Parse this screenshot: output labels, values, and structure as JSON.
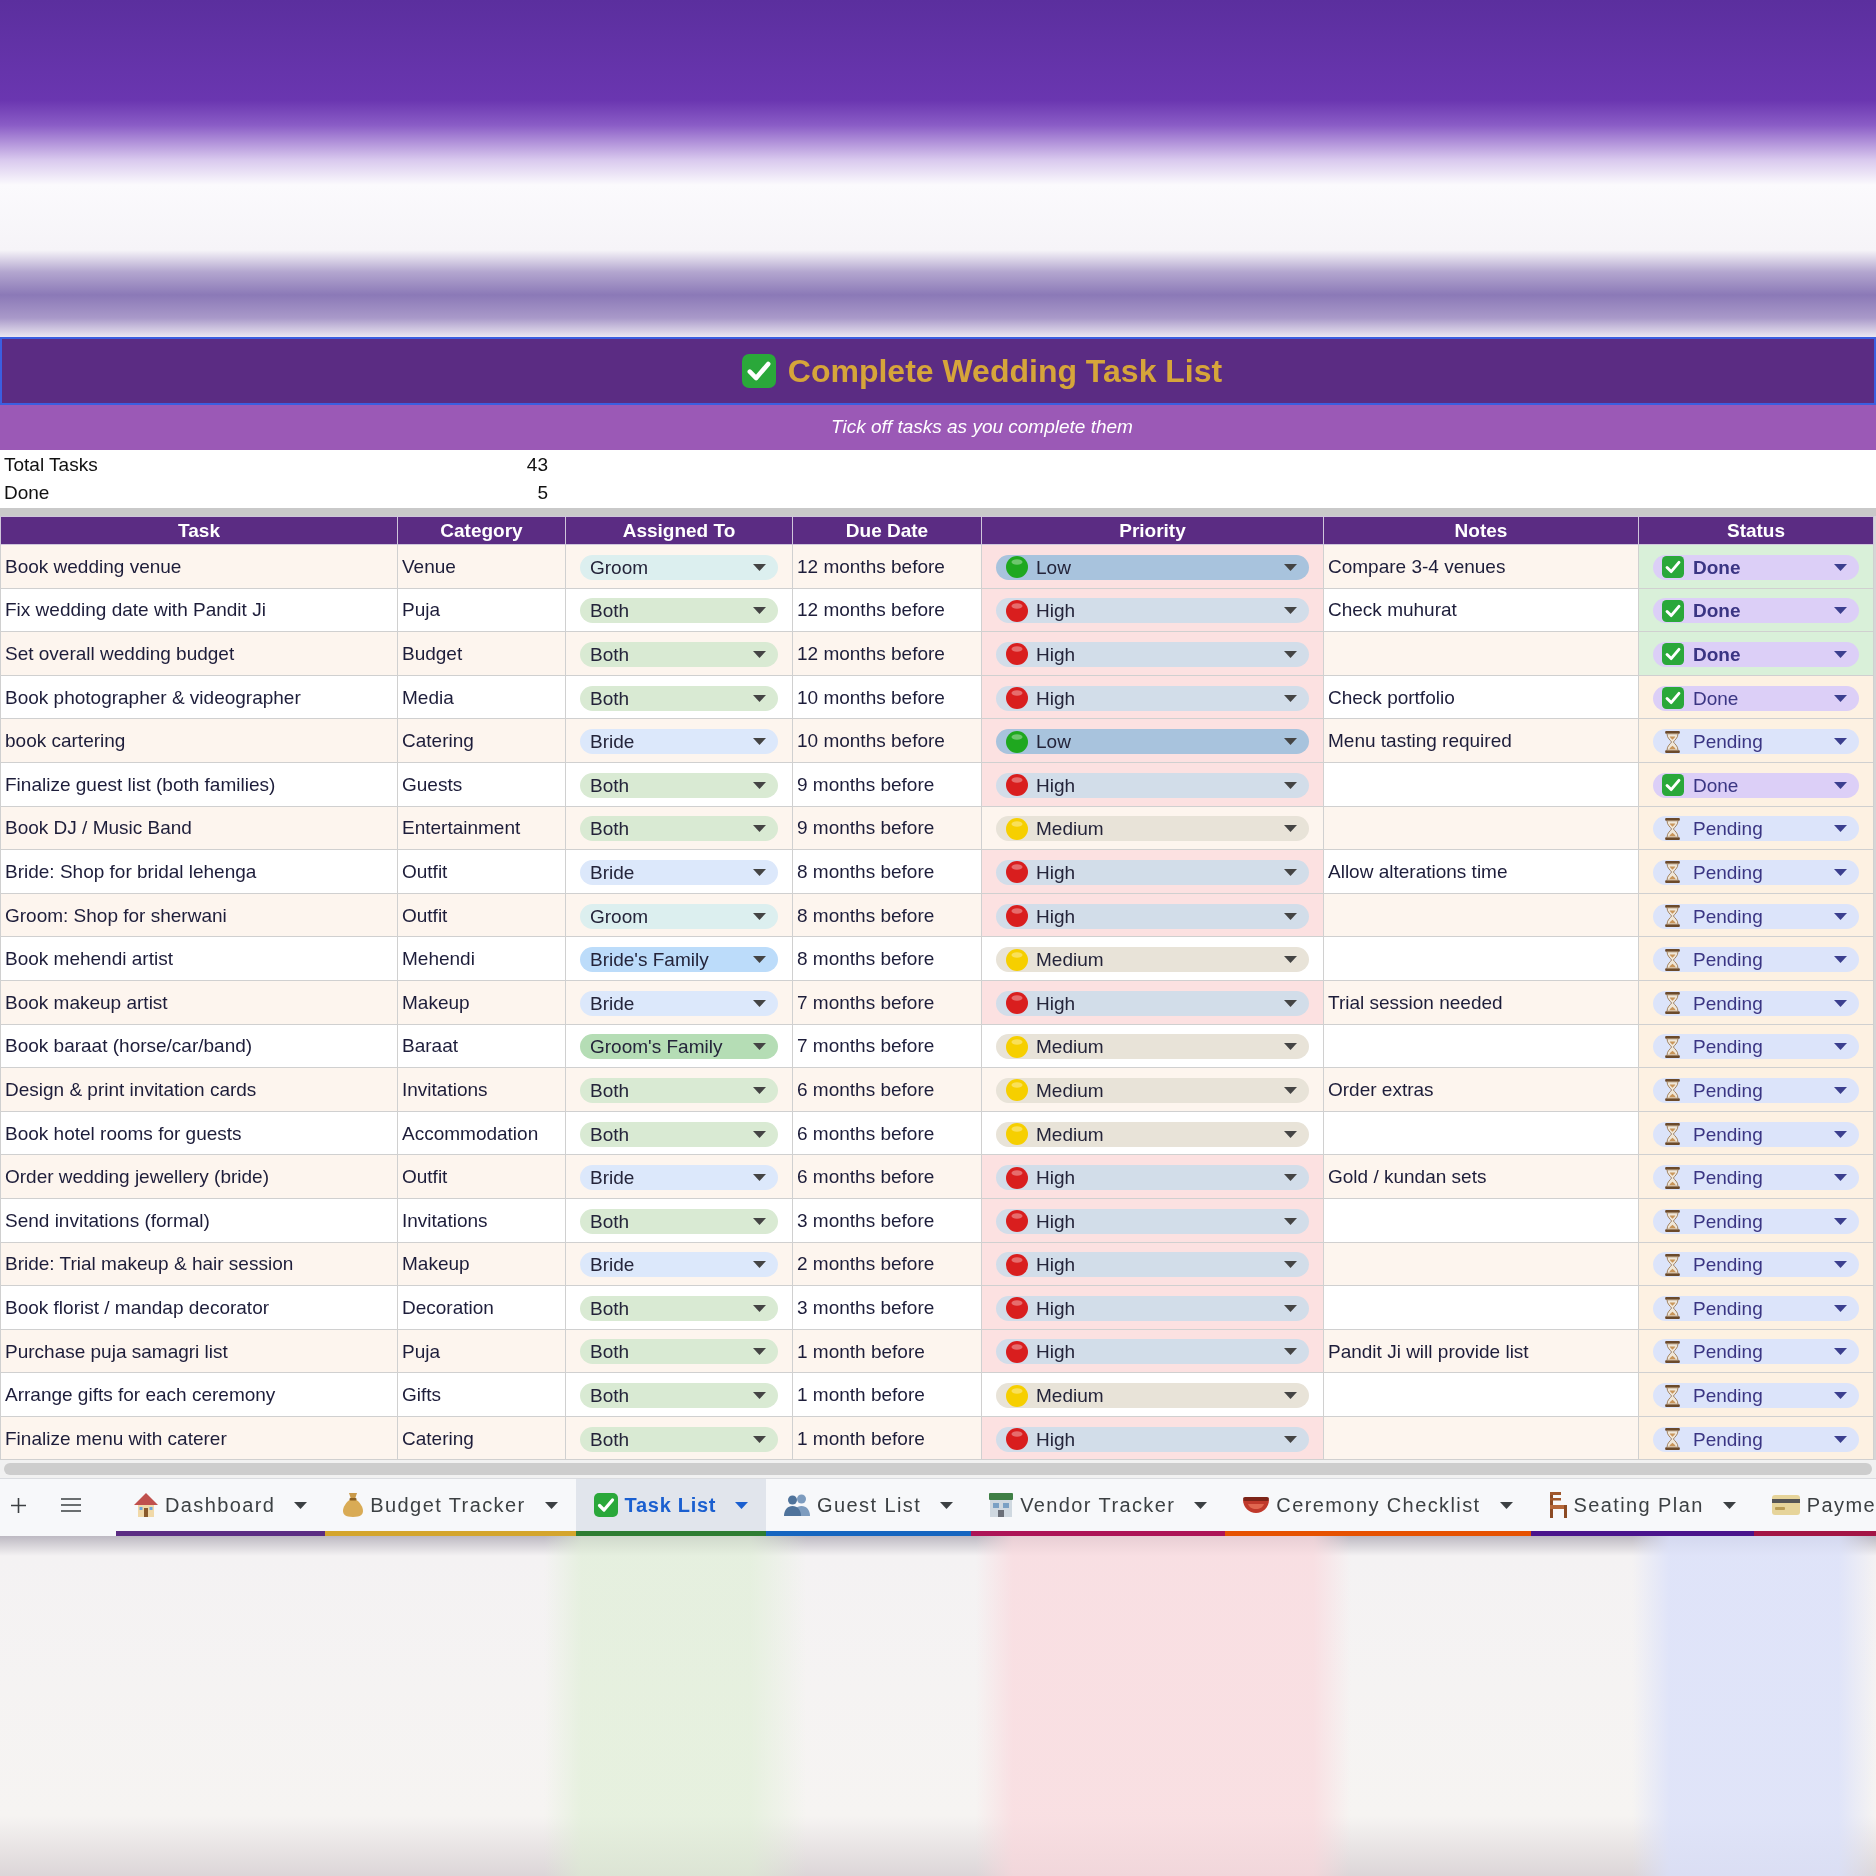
{
  "title_banner": {
    "text": "Complete Wedding Task List",
    "selected": true
  },
  "subtitle": "Tick off tasks as you complete them",
  "summary": [
    {
      "label": "Total Tasks",
      "value": "43"
    },
    {
      "label": "Done",
      "value": "5"
    }
  ],
  "table": {
    "columns": [
      "Task",
      "Category",
      "Assigned To",
      "Due Date",
      "Priority",
      "Notes",
      "Status"
    ],
    "rows": [
      {
        "task": "Book wedding venue",
        "category": "Venue",
        "assigned_to": {
          "label": "Groom",
          "color": "#dcefef"
        },
        "due_date": "12 months before",
        "priority": {
          "label": "Low",
          "kind": "low"
        },
        "notes": "Compare 3-4 venues",
        "status": {
          "label": "Done",
          "kind": "done",
          "highlighted": true
        }
      },
      {
        "task": "Fix wedding date with Pandit Ji",
        "category": "Puja",
        "assigned_to": {
          "label": "Both",
          "color": "#d9ead3"
        },
        "due_date": "12 months before",
        "priority": {
          "label": "High",
          "kind": "high"
        },
        "notes": "Check muhurat",
        "status": {
          "label": "Done",
          "kind": "done",
          "highlighted": true
        }
      },
      {
        "task": "Set overall wedding budget",
        "category": "Budget",
        "assigned_to": {
          "label": "Both",
          "color": "#d9ead3"
        },
        "due_date": "12 months before",
        "priority": {
          "label": "High",
          "kind": "high"
        },
        "status": {
          "label": "Done",
          "kind": "done",
          "highlighted": true
        }
      },
      {
        "task": "Book photographer & videographer",
        "category": "Media",
        "assigned_to": {
          "label": "Both",
          "color": "#d9ead3"
        },
        "due_date": "10 months before",
        "priority": {
          "label": "High",
          "kind": "high"
        },
        "notes": "Check portfolio",
        "status": {
          "label": "Done",
          "kind": "done",
          "highlighted": false
        }
      },
      {
        "task": "book cartering",
        "category": "Catering",
        "assigned_to": {
          "label": "Bride",
          "color": "#dce8fb"
        },
        "due_date": "10 months before",
        "priority": {
          "label": "Low",
          "kind": "low"
        },
        "notes": "Menu tasting required",
        "status": {
          "label": "Pending",
          "kind": "pending",
          "highlighted": false
        }
      },
      {
        "task": "Finalize guest list (both families)",
        "category": "Guests",
        "assigned_to": {
          "label": "Both",
          "color": "#d9ead3"
        },
        "due_date": "9 months before",
        "priority": {
          "label": "High",
          "kind": "high"
        },
        "status": {
          "label": "Done",
          "kind": "done",
          "highlighted": false
        }
      },
      {
        "task": "Book DJ / Music Band",
        "category": "Entertainment",
        "assigned_to": {
          "label": "Both",
          "color": "#d9ead3"
        },
        "due_date": "9 months before",
        "priority": {
          "label": "Medium",
          "kind": "medium"
        },
        "status": {
          "label": "Pending",
          "kind": "pending",
          "highlighted": false
        }
      },
      {
        "task": "Bride: Shop for bridal lehenga",
        "category": "Outfit",
        "assigned_to": {
          "label": "Bride",
          "color": "#dce8fb"
        },
        "due_date": "8 months before",
        "priority": {
          "label": "High",
          "kind": "high"
        },
        "notes": "Allow alterations time",
        "status": {
          "label": "Pending",
          "kind": "pending",
          "highlighted": false
        }
      },
      {
        "task": "Groom: Shop for sherwani",
        "category": "Outfit",
        "assigned_to": {
          "label": "Groom",
          "color": "#dcefef"
        },
        "due_date": "8 months before",
        "priority": {
          "label": "High",
          "kind": "high"
        },
        "status": {
          "label": "Pending",
          "kind": "pending",
          "highlighted": false
        }
      },
      {
        "task": "Book mehendi artist",
        "category": "Mehendi",
        "assigned_to": {
          "label": "Bride's Family",
          "color": "#bcdcfa"
        },
        "due_date": "8 months before",
        "priority": {
          "label": "Medium",
          "kind": "medium"
        },
        "status": {
          "label": "Pending",
          "kind": "pending",
          "highlighted": false
        }
      },
      {
        "task": "Book makeup artist",
        "category": "Makeup",
        "assigned_to": {
          "label": "Bride",
          "color": "#dce8fb"
        },
        "due_date": "7 months before",
        "priority": {
          "label": "High",
          "kind": "high"
        },
        "notes": "Trial session needed",
        "status": {
          "label": "Pending",
          "kind": "pending",
          "highlighted": false
        }
      },
      {
        "task": "Book baraat (horse/car/band)",
        "category": "Baraat",
        "assigned_to": {
          "label": "Groom's Family",
          "color": "#b5ddb5"
        },
        "due_date": "7 months before",
        "priority": {
          "label": "Medium",
          "kind": "medium"
        },
        "status": {
          "label": "Pending",
          "kind": "pending",
          "highlighted": false
        }
      },
      {
        "task": "Design & print invitation cards",
        "category": "Invitations",
        "assigned_to": {
          "label": "Both",
          "color": "#d9ead3"
        },
        "due_date": "6 months before",
        "priority": {
          "label": "Medium",
          "kind": "medium"
        },
        "notes": "Order extras",
        "status": {
          "label": "Pending",
          "kind": "pending",
          "highlighted": false
        }
      },
      {
        "task": "Book hotel rooms for guests",
        "category": "Accommodation",
        "assigned_to": {
          "label": "Both",
          "color": "#d9ead3"
        },
        "due_date": "6 months before",
        "priority": {
          "label": "Medium",
          "kind": "medium"
        },
        "status": {
          "label": "Pending",
          "kind": "pending",
          "highlighted": false
        }
      },
      {
        "task": "Order wedding jewellery (bride)",
        "category": "Outfit",
        "assigned_to": {
          "label": "Bride",
          "color": "#dce8fb"
        },
        "due_date": "6 months before",
        "priority": {
          "label": "High",
          "kind": "high"
        },
        "notes": "Gold / kundan sets",
        "status": {
          "label": "Pending",
          "kind": "pending",
          "highlighted": false
        }
      },
      {
        "task": "Send invitations (formal)",
        "category": "Invitations",
        "assigned_to": {
          "label": "Both",
          "color": "#d9ead3"
        },
        "due_date": "3 months before",
        "priority": {
          "label": "High",
          "kind": "high"
        },
        "status": {
          "label": "Pending",
          "kind": "pending",
          "highlighted": false
        }
      },
      {
        "task": "Bride: Trial makeup & hair session",
        "category": "Makeup",
        "assigned_to": {
          "label": "Bride",
          "color": "#dce8fb"
        },
        "due_date": "2 months before",
        "priority": {
          "label": "High",
          "kind": "high"
        },
        "status": {
          "label": "Pending",
          "kind": "pending",
          "highlighted": false
        }
      },
      {
        "task": "Book florist / mandap decorator",
        "category": "Decoration",
        "assigned_to": {
          "label": "Both",
          "color": "#d9ead3"
        },
        "due_date": "3 months before",
        "priority": {
          "label": "High",
          "kind": "high"
        },
        "status": {
          "label": "Pending",
          "kind": "pending",
          "highlighted": false
        }
      },
      {
        "task": "Purchase puja samagri list",
        "category": "Puja",
        "assigned_to": {
          "label": "Both",
          "color": "#d9ead3"
        },
        "due_date": "1 month before",
        "priority": {
          "label": "High",
          "kind": "high"
        },
        "notes": "Pandit Ji will provide list",
        "status": {
          "label": "Pending",
          "kind": "pending",
          "highlighted": false
        }
      },
      {
        "task": "Arrange gifts for each ceremony",
        "category": "Gifts",
        "assigned_to": {
          "label": "Both",
          "color": "#d9ead3"
        },
        "due_date": "1 month before",
        "priority": {
          "label": "Medium",
          "kind": "medium"
        },
        "status": {
          "label": "Pending",
          "kind": "pending",
          "highlighted": false
        }
      },
      {
        "task": "Finalize menu with caterer",
        "category": "Catering",
        "assigned_to": {
          "label": "Both",
          "color": "#d9ead3"
        },
        "due_date": "1 month before",
        "priority": {
          "label": "High",
          "kind": "high"
        },
        "status": {
          "label": "Pending",
          "kind": "pending",
          "highlighted": false
        }
      }
    ]
  },
  "sheet_tabs": [
    {
      "label": "Dashboard",
      "color": "#5b2c83",
      "selected": false,
      "truncated": false
    },
    {
      "label": "Budget Tracker",
      "color": "#d4a52c",
      "selected": false,
      "truncated": false
    },
    {
      "label": "Task List",
      "color": "#2e7d32",
      "selected": true,
      "truncated": false
    },
    {
      "label": "Guest List",
      "color": "#1565c0",
      "selected": false,
      "truncated": false
    },
    {
      "label": "Vendor Tracker",
      "color": "#ad1457",
      "selected": false,
      "truncated": false
    },
    {
      "label": "Ceremony Checklist",
      "color": "#e65100",
      "selected": false,
      "truncated": false
    },
    {
      "label": "Seating Plan",
      "color": "#4a148c",
      "selected": false,
      "truncated": false
    },
    {
      "label": "Payme",
      "color": "#a31545",
      "selected": false,
      "truncated": true
    }
  ]
}
